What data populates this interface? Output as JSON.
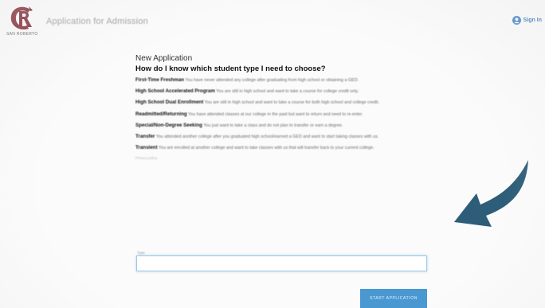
{
  "header": {
    "app_title": "Application for Admission",
    "logo_sub": "SAN ROBERTO",
    "signin_label": "Sign In",
    "logo_icon": "college-crest-logo",
    "user_icon": "user-circle-icon"
  },
  "main": {
    "heading": "New Application",
    "question": "How do I know which student type I need to choose?",
    "student_types": [
      {
        "name": "First-Time Freshman",
        "desc": "You have never attended any college after graduating from high school or obtaining a GED."
      },
      {
        "name": "High School Accelerated Program",
        "desc": "You are still in high school and want to take a course for college credit only."
      },
      {
        "name": "High School Dual Enrollment",
        "desc": "You are still in high school and want to take a course for both high school and college credit."
      },
      {
        "name": "Readmitted/Returning",
        "desc": "You have attended classes at our college in the past but want to return and need to re-enter."
      },
      {
        "name": "Special/Non-Degree Seeking",
        "desc": "You just want to take a class and do not plan to transfer or earn a degree."
      },
      {
        "name": "Transfer",
        "desc": "You attended another college after you graduated high school/earned a GED and want to start taking classes with us."
      },
      {
        "name": "Transient",
        "desc": "You are enrolled at another college and want to take classes with us that will transfer back to your current college."
      }
    ],
    "faint_link": "Privacy policy"
  },
  "form": {
    "field_label": "Type",
    "field_value": "",
    "start_button_label": "START APPLICATION"
  },
  "colors": {
    "accent_button": "#4a98d2",
    "arrow": "#2d5d78",
    "signin": "#2f6db0",
    "logo": "#7a1f2b"
  }
}
